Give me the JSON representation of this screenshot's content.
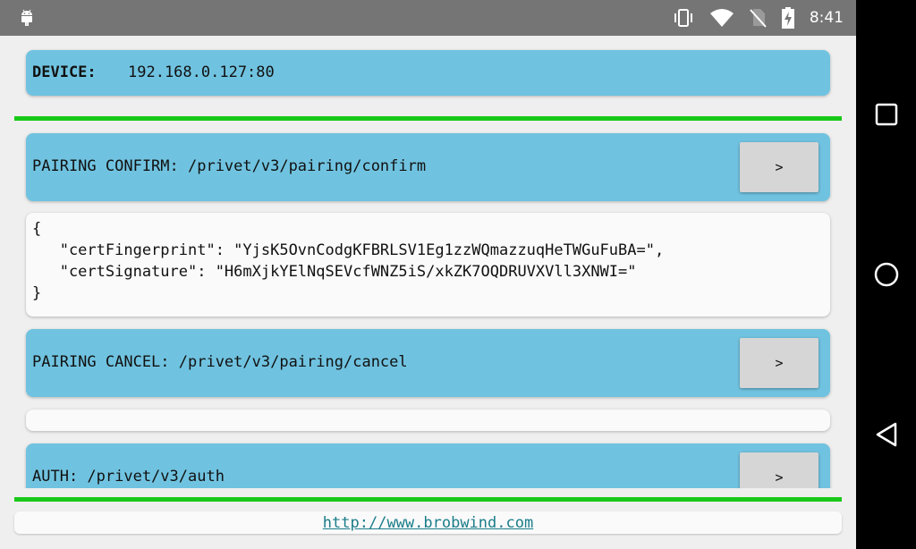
{
  "statusbar": {
    "time": "8:41",
    "icons": [
      "android-icon",
      "vibrate-icon",
      "wifi-icon",
      "no-sim-icon",
      "battery-charging-icon"
    ]
  },
  "device": {
    "label": "DEVICE:",
    "address": "192.168.0.127:80"
  },
  "endpoints": [
    {
      "title": "PAIRING CONFIRM: /privet/v3/pairing/confirm",
      "button": ">",
      "response": "{\n   \"certFingerprint\": \"YjsK5OvnCodgKFBRLSV1Eg1zzWQmazzuqHeTWGuFuBA=\",\n   \"certSignature\": \"H6mXjkYElNqSEVcfWNZ5iS/xkZK7OQDRUVXVll3XNWI=\"\n}"
    },
    {
      "title": "PAIRING CANCEL: /privet/v3/pairing/cancel",
      "button": ">",
      "response": ""
    },
    {
      "title": "AUTH: /privet/v3/auth",
      "button": ">"
    }
  ],
  "footer": {
    "link": "http://www.brobwind.com"
  },
  "colors": {
    "card_blue": "#70c3e0",
    "divider_green": "#18c918",
    "statusbar": "#757575",
    "link": "#1a7d8a"
  },
  "navbar": {
    "buttons": [
      "recents-square-icon",
      "home-circle-icon",
      "back-triangle-icon"
    ]
  }
}
